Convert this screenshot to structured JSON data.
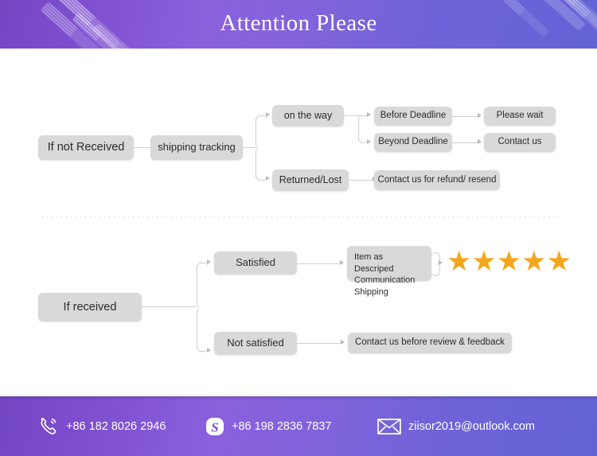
{
  "header": {
    "title": "Attention Please",
    "gradient_start": "#7346c4",
    "gradient_mid": "#8b60dd",
    "gradient_end": "#6563d6",
    "decor_icon": "diagonal-ribbon-stripes"
  },
  "flow_not_received": {
    "root": "If not Received",
    "step2": "shipping tracking",
    "branch_a": {
      "label": "on the way",
      "children": [
        {
          "condition": "Before Deadline",
          "result": "Please wait"
        },
        {
          "condition": "Beyond Deadline",
          "result": "Contact us"
        }
      ]
    },
    "branch_b": {
      "label": "Returned/Lost",
      "result": "Contact us for refund/ resend"
    }
  },
  "flow_received": {
    "root": "If received",
    "branch_a": {
      "label": "Satisfied",
      "criteria_line1": "Item as Descriped",
      "criteria_line2": "Communication",
      "criteria_line3": "Shipping",
      "rating_stars": 5,
      "rating_glyph": "★",
      "star_color": "#f4a61b"
    },
    "branch_b": {
      "label": "Not satisfied",
      "result": "Contact us before review & feedback"
    }
  },
  "footer": {
    "phone": {
      "icon": "phone-ringing-icon",
      "value": "+86 182 8026 2946"
    },
    "skype": {
      "icon": "skype-icon",
      "value": "+86 198 2836 7837"
    },
    "email": {
      "icon": "envelope-icon",
      "value": "ziisor2019@outlook.com"
    }
  },
  "theme": {
    "node_fill": "#d9d9d9",
    "node_text": "#2b2b2b",
    "connector": "#cfcfcf",
    "divider": "#f0f0f0"
  }
}
